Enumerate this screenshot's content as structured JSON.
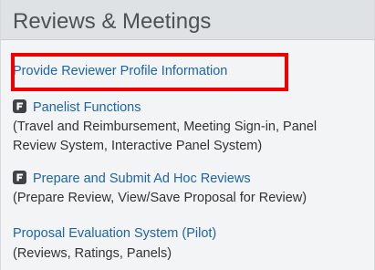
{
  "section": {
    "title": "Reviews & Meetings"
  },
  "items": [
    {
      "link": "Provide Reviewer Profile Information"
    },
    {
      "icon": "f-icon",
      "link": "Panelist Functions",
      "description_line1": "(Travel and Reimbursement, Meeting Sign-in, Panel",
      "description_line2": "Review System, Interactive Panel System)"
    },
    {
      "icon": "f-icon",
      "link": "Prepare and Submit Ad Hoc Reviews",
      "description_line1": "(Prepare Review, View/Save Proposal for Review)"
    },
    {
      "link": "Proposal Evaluation System (Pilot)",
      "description_line1": "(Reviews, Ratings, Panels)"
    }
  ],
  "colors": {
    "link": "#1f64a6",
    "highlight_border": "#f20000",
    "header_background": "#dfe2e5",
    "panel_background": "#f3f4f5"
  }
}
